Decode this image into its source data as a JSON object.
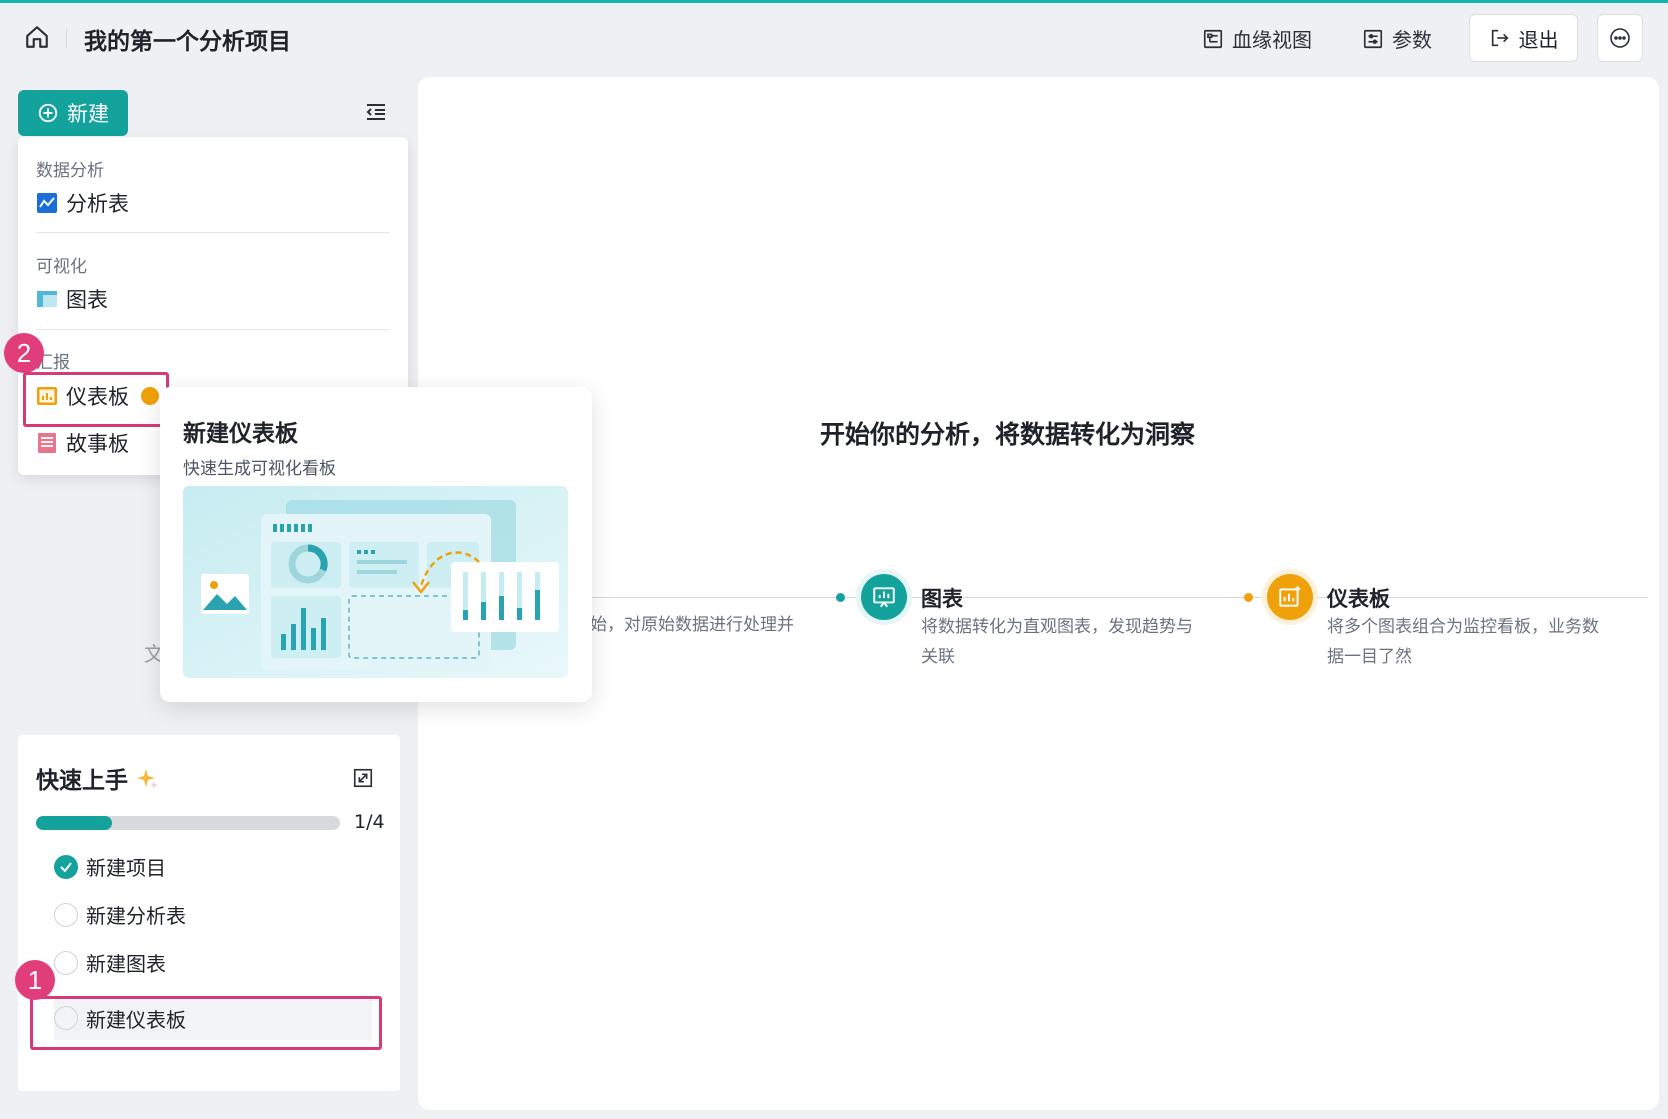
{
  "header": {
    "project_title": "我的第一个分析项目",
    "lineage_label": "血缘视图",
    "params_label": "参数",
    "exit_label": "退出"
  },
  "sidebar": {
    "new_label": "新建",
    "dropdown": {
      "sections": [
        {
          "title": "数据分析",
          "items": [
            {
              "label": "分析表",
              "icon": "line-chart-icon"
            }
          ]
        },
        {
          "title": "可视化",
          "items": [
            {
              "label": "图表",
              "icon": "table-chart-icon"
            }
          ]
        },
        {
          "title": "汇报",
          "items": [
            {
              "label": "仪表板",
              "icon": "dashboard-icon"
            },
            {
              "label": "故事板",
              "icon": "storyboard-icon"
            }
          ]
        }
      ]
    },
    "partial_text": "文"
  },
  "annotations": {
    "badge_1": "1",
    "badge_2": "2"
  },
  "tooltip": {
    "title": "新建仪表板",
    "subtitle": "快速生成可视化看板"
  },
  "quick_start": {
    "title": "快速上手",
    "progress_text": "1/4",
    "progress_fraction": 0.25,
    "tasks": [
      {
        "label": "新建项目",
        "done": true
      },
      {
        "label": "新建分析表",
        "done": false
      },
      {
        "label": "新建图表",
        "done": false
      },
      {
        "label": "新建仪表板",
        "done": false
      }
    ]
  },
  "main": {
    "heading": "开始你的分析，将数据转化为洞察",
    "step1_partial": "始，对原始数据进行处理并",
    "steps": [
      {
        "title": "图表",
        "desc_line1": "将数据转化为直观图表，发现趋势与",
        "desc_line2": "关联",
        "color": "#13a39c"
      },
      {
        "title": "仪表板",
        "desc_line1": "将多个图表组合为监控看板，业务数",
        "desc_line2": "据一目了然",
        "color": "#f0a10a"
      }
    ]
  },
  "colors": {
    "accent": "#13a39c",
    "highlight": "#d63a7a",
    "badge": "#e23d7b",
    "orange": "#f0a10a"
  }
}
